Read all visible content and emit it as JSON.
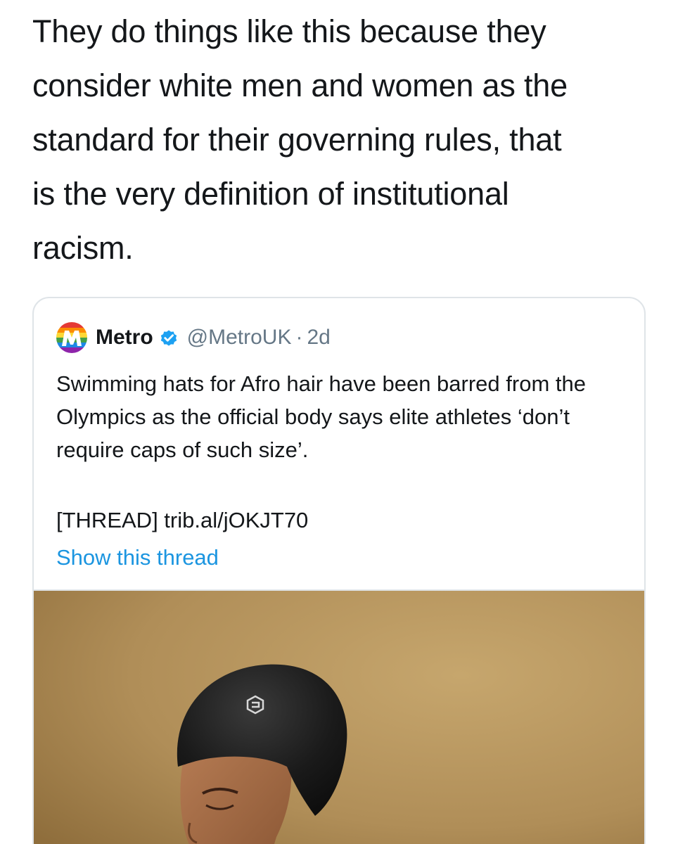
{
  "tweet": {
    "text": "They do things like this because they\nconsider white men and women as the\nstandard for their governing rules, that\nis the very definition of institutional\nracism."
  },
  "quoted_tweet": {
    "author_name": "Metro",
    "handle": "@MetroUK",
    "separator": "·",
    "time": "2d",
    "verified": true,
    "body": "Swimming hats for Afro hair have been barred from the Olympics as the official body says elite athletes ‘don’t require caps of such size’.",
    "link_text": "[THREAD] trib.al/jOKJT70",
    "show_thread_label": "Show this thread",
    "colors": {
      "link_blue": "#1b95e0",
      "verified_blue": "#1da1f2",
      "muted_gray": "#657786",
      "photo_background": "#b08e58"
    },
    "media": {
      "description_icon": "photo-swimmer-cap"
    }
  }
}
